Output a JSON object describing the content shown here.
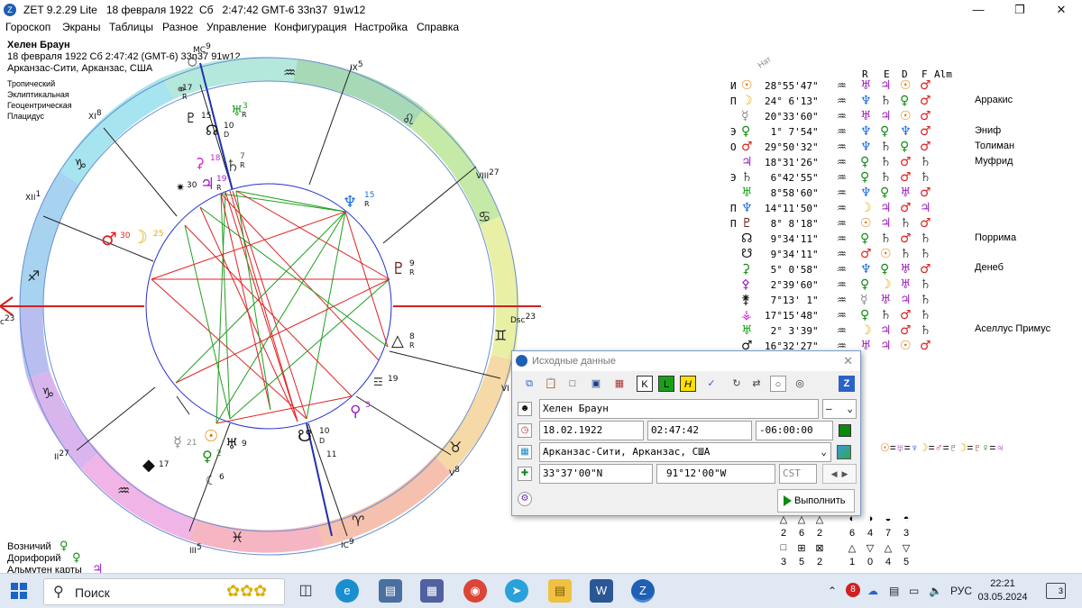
{
  "window": {
    "title": "ZET 9.2.29 Lite   18 февраля 1922  Сб   2:47:42 GMT-6 33n37  91w12",
    "minimize_icon": "minimize-icon",
    "maximize_icon": "restore-icon",
    "close_icon": "close-icon"
  },
  "menu": [
    "Гороскоп",
    "Экраны",
    "Таблицы",
    "Разное",
    "Управление",
    "Конфигурация",
    "Настройка",
    "Справка"
  ],
  "chart_header": {
    "name": "Хелен Браун",
    "datetime": "18 февраля 1922  Сб   2:47:42 (GMT-6) 33n37  91w12",
    "place": "Арканзас-Сити, Арканзас, США",
    "options": [
      "Тропический",
      "Эклиптикальная",
      "Геоцентрическая",
      "Плацидус"
    ]
  },
  "wheel": {
    "house_labels": [
      {
        "label": "MC",
        "sup": "9"
      },
      {
        "label": "IX",
        "sup": "5"
      },
      {
        "label": "VIII",
        "sup": "27"
      },
      {
        "label": "Dsc",
        "sup": "23"
      },
      {
        "label": "VI",
        "sup": ""
      },
      {
        "label": "V",
        "sup": "8"
      },
      {
        "label": "IC",
        "sup": "9"
      },
      {
        "label": "III",
        "sup": "5"
      },
      {
        "label": "II",
        "sup": "27"
      },
      {
        "label": "c",
        "sup": "23"
      },
      {
        "label": "XII",
        "sup": "1"
      },
      {
        "label": "XI",
        "sup": "8"
      }
    ],
    "planet_degrees": [
      "17",
      "15",
      "10",
      "3",
      "7",
      "18",
      "19",
      "30",
      "15",
      "9",
      "8",
      "19",
      "3",
      "10",
      "11",
      "21",
      "2",
      "9",
      "6",
      "17",
      "25",
      "30"
    ],
    "retro_marks": [
      "R",
      "D",
      "R",
      "R",
      "R",
      "R",
      "R",
      "R",
      "D"
    ]
  },
  "table": {
    "header_tag": "Нат",
    "columns": [
      "R",
      "E",
      "D",
      "F",
      "Alm"
    ],
    "rows": [
      {
        "prefix": "И",
        "pos": "28°55'47\"",
        "star": ""
      },
      {
        "prefix": "П",
        "pos": "24° 6'13\"",
        "star": "Арракис"
      },
      {
        "prefix": "",
        "pos": "20°33'60\"",
        "star": ""
      },
      {
        "prefix": "Э",
        "pos": " 1° 7'54\"",
        "star": "Эниф"
      },
      {
        "prefix": "О",
        "pos": "29°50'32\"",
        "star": "Толиман"
      },
      {
        "prefix": "",
        "pos": "18°31'26\"",
        "star": "Муфрид"
      },
      {
        "prefix": "Э",
        "pos": " 6°42'55\"",
        "star": ""
      },
      {
        "prefix": "",
        "pos": " 8°58'60\"",
        "star": ""
      },
      {
        "prefix": "П",
        "pos": "14°11'50\"",
        "star": ""
      },
      {
        "prefix": "П",
        "pos": " 8° 8'18\"",
        "star": ""
      },
      {
        "prefix": "",
        "pos": " 9°34'11\"",
        "star": "Поррима"
      },
      {
        "prefix": "",
        "pos": " 9°34'11\"",
        "star": ""
      },
      {
        "prefix": "",
        "pos": " 5° 0'58\"",
        "star": "Денеб"
      },
      {
        "prefix": "",
        "pos": " 2°39'60\"",
        "star": ""
      },
      {
        "prefix": "",
        "pos": " 7°13' 1\"",
        "star": ""
      },
      {
        "prefix": "",
        "pos": "17°15'48\"",
        "star": ""
      },
      {
        "prefix": "",
        "pos": " 2° 3'39\"",
        "star": "Аселлус Примус"
      },
      {
        "prefix": "",
        "pos": "16°32'27\"",
        "star": ""
      }
    ]
  },
  "dialog": {
    "title": "Исходные данные",
    "name_value": "Хелен Браун",
    "sign_value": "–",
    "date_value": "18.02.1922",
    "time_value": "02:47:42",
    "zone_value": "-06:00:00",
    "place_value": "Арканзас-Сити, Арканзас, США",
    "lat_value": "33°37'00\"N",
    "lon_value": "91°12'00\"W",
    "tz_value": "CST",
    "run_label": "Выполнить",
    "toolbar_letters": [
      "K",
      "L",
      "H"
    ]
  },
  "bottom_left": {
    "items": [
      "Возничий",
      "Дорифорий",
      "Альмутен карты"
    ]
  },
  "modes": {
    "row1": [
      "2",
      "6",
      "2",
      "6",
      "4",
      "7",
      "3"
    ],
    "row2": [
      "3",
      "5",
      "2",
      "1",
      "0",
      "4",
      "5"
    ]
  },
  "taskbar": {
    "search_placeholder": "Поиск",
    "lang": "РУС",
    "time": "22:21",
    "date": "03.05.2024",
    "notif_count": "3"
  },
  "colors": {
    "accent_red": "#e02020",
    "accent_green": "#138a13",
    "accent_blue": "#2b4bd6",
    "purple": "#a020c0"
  }
}
